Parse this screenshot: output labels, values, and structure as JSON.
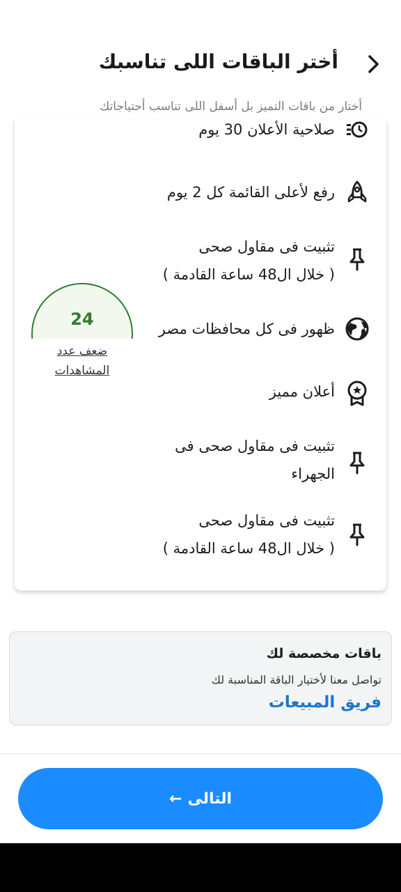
{
  "header": {
    "title": "أختر الباقات اللى تناسبك",
    "subtitle": "أختار من باقات التميز بل أسفل اللى تناسب أحتياجاتك"
  },
  "features": [
    {
      "icon": "clock-list-icon",
      "text": "صلاحية الأعلان 30 يوم"
    },
    {
      "icon": "rocket-icon",
      "text": "رفع لأعلى القائمة كل 2 يوم"
    },
    {
      "icon": "pin-icon",
      "text_line1": "تثبيت فى مقاول صحى",
      "text_line2": "( خلال ال48 ساعة القادمة )"
    },
    {
      "icon": "globe-icon",
      "text": "ظهور فى كل محافظات مصر"
    },
    {
      "icon": "award-icon",
      "text": "أعلان مميز"
    },
    {
      "icon": "pin-icon",
      "text_line1": "تثبيت فى مقاول صحى فى",
      "text_line2": "الجهراء"
    },
    {
      "icon": "pin-icon",
      "text_line1": "تثبيت فى مقاول صحى",
      "text_line2": "( خلال ال48 ساعة القادمة )"
    }
  ],
  "badge": {
    "number": "24",
    "label_line1": "ضعف عدد",
    "label_line2": "المشاهدات",
    "color": "#2f7d32"
  },
  "custom_packages": {
    "title": "باقات مخصصة لك",
    "description": "تواصل معنا لأختيار الباقة المناسبة لك",
    "link": "فريق المبيعات"
  },
  "next_button": {
    "label": "التالى",
    "arrow": "←",
    "color": "#1a8cff"
  }
}
